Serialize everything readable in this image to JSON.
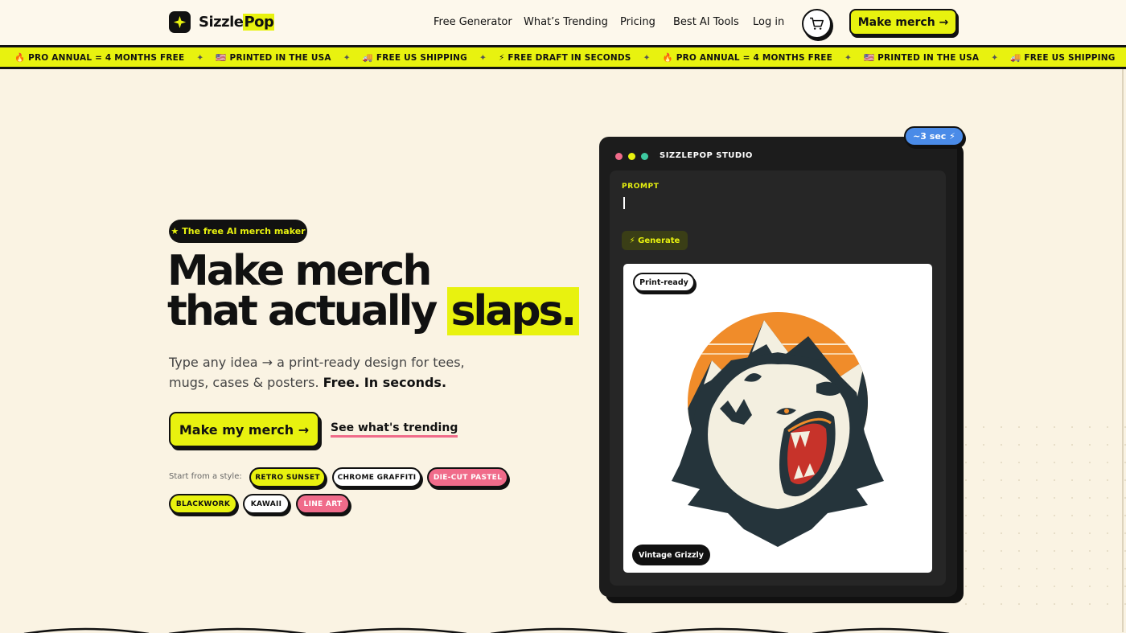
{
  "header": {
    "logo_icon": "sparkle-icon",
    "brand_first": "Sizzle",
    "brand_second": "Pop",
    "nav": [
      "Free Generator",
      "What’s Trending",
      "Pricing",
      "Best AI Tools",
      "Log in"
    ],
    "cart_icon": "cart-icon",
    "cta_label": "Make merch →"
  },
  "ticker": {
    "items": [
      "🔥 PRO ANNUAL = 4 MONTHS FREE",
      "🇺🇸 PRINTED IN THE USA",
      "🚚 FREE US SHIPPING",
      "⚡ FREE DRAFT IN SECONDS",
      "🔥 PRO ANNUAL = 4 MONTHS FREE",
      "🇺🇸 PRINTED IN THE USA",
      "🚚 FREE US SHIPPING",
      "⚡ FREE DRAFT IN SECONDS"
    ],
    "separator": "✦"
  },
  "hero": {
    "pill": "The free AI merch maker",
    "pill_icon": "star-icon",
    "headline_line1": "Make merch",
    "headline_line2": "that actually",
    "headline_highlight": "slaps.",
    "sub_text": "Type any idea → a print-ready design for tees, mugs, cases & posters.",
    "sub_emphasis": "Free. In seconds.",
    "cta_primary": "Make my merch →",
    "cta_secondary": "See what's trending",
    "style_label": "Start from a style:",
    "styles": [
      "RETRO SUNSET",
      "CHROME GRAFFITI",
      "DIE-CUT PASTEL",
      "BLACKWORK",
      "KAWAII",
      "LINE ART"
    ]
  },
  "studio": {
    "badge": "~3 sec ⚡",
    "title": "SIZZLEPOP STUDIO",
    "prompt_label": "PROMPT",
    "prompt_value": "",
    "generate_label": "⚡ Generate",
    "print_chip": "Print-ready",
    "design_name": "Vintage Grizzly"
  },
  "colors": {
    "accent": "#e8f20f",
    "background": "#faf3e3",
    "pink": "#f06b8a",
    "blue": "#4a8be8",
    "dark": "#111111"
  }
}
